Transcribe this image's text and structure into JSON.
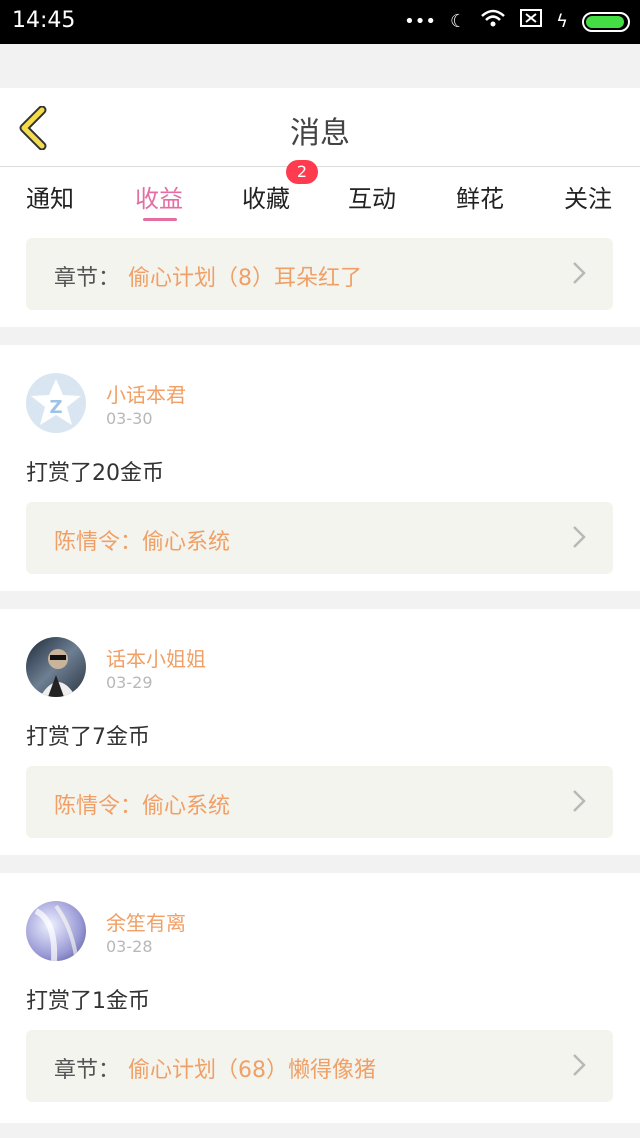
{
  "status_bar": {
    "time": "14:45",
    "icons": [
      "dots-icon",
      "moon-icon",
      "wifi-icon",
      "sim-icon",
      "charging-icon",
      "battery-icon"
    ]
  },
  "header": {
    "title": "消息"
  },
  "tabs": [
    {
      "label": "通知"
    },
    {
      "label": "收益",
      "active": true
    },
    {
      "label": "收藏",
      "badge": "2"
    },
    {
      "label": "互动"
    },
    {
      "label": "鲜花"
    },
    {
      "label": "关注"
    }
  ],
  "top_link": {
    "prefix": "章节：",
    "text": "偷心计划（8）耳朵红了"
  },
  "items": [
    {
      "user": "小话本君",
      "date": "03-30",
      "reward": "打赏了20金币",
      "link_text": "陈情令：偷心系统"
    },
    {
      "user": "话本小姐姐",
      "date": "03-29",
      "reward": "打赏了7金币",
      "link_text": "陈情令：偷心系统"
    },
    {
      "user": "余笙有离",
      "date": "03-28",
      "reward": "打赏了1金币",
      "link_prefix": "章节：",
      "link_text": "偷心计划（68）懒得像猪"
    }
  ],
  "colors": {
    "accent": "#e46ea3",
    "orange": "#f0a066",
    "badge": "#ff3b4f",
    "panel": "#f4f4ef"
  }
}
